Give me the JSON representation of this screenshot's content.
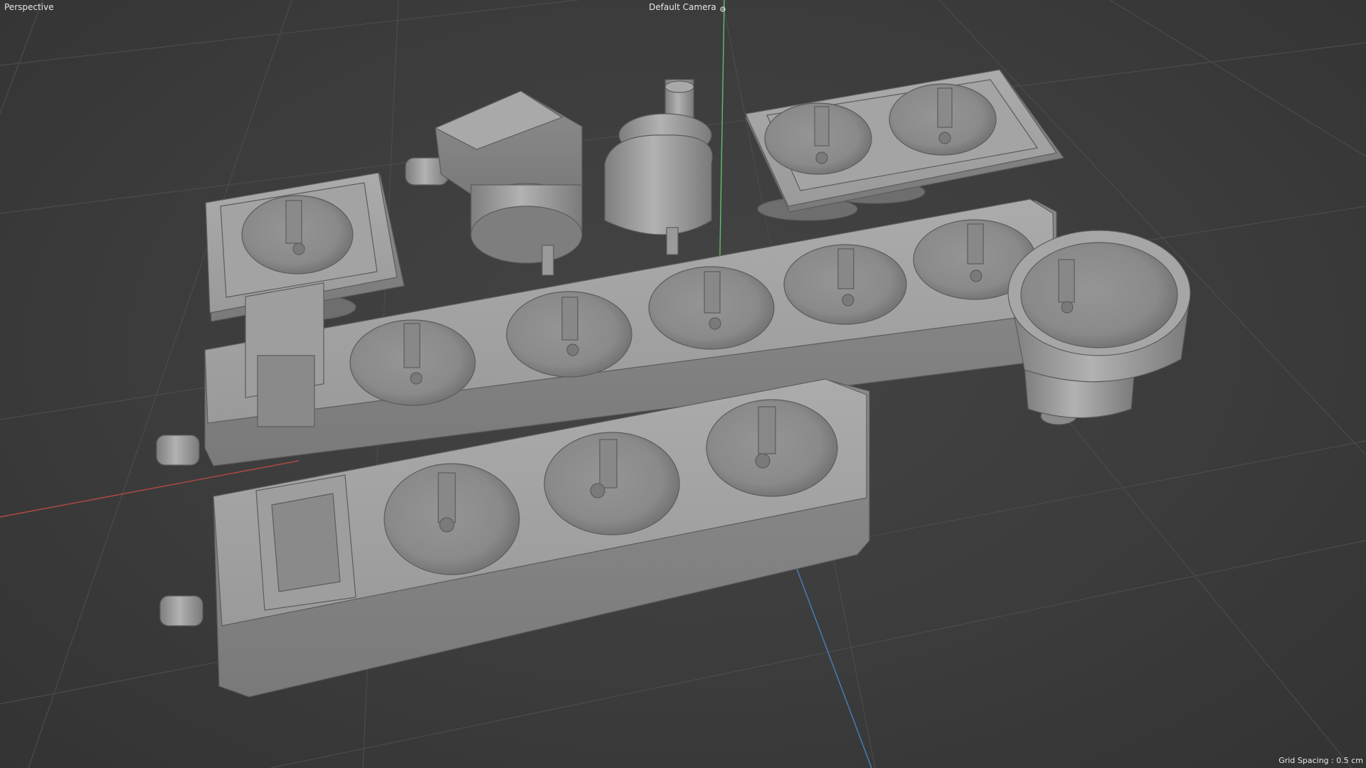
{
  "viewport": {
    "view_name": "Perspective",
    "camera_label": "Default Camera",
    "camera_icon": "camera-target-icon",
    "grid_spacing": "Grid Spacing : 0.5 cm"
  },
  "colors": {
    "background": "#3a3a3a",
    "grid_line": "#4a4a4a",
    "axis_x": "#b34a45",
    "axis_y": "#5fbf6a",
    "axis_z": "#4a7fc0",
    "model_light": "#a8a8a8",
    "model_mid": "#8f8f8f",
    "model_dark": "#6a6a6a",
    "hud_text": "#e8e8e8"
  },
  "scene": {
    "objects": [
      "power-strip-3-socket",
      "power-strip-5-socket",
      "single-wall-socket",
      "double-wall-socket",
      "angled-plug-adapter",
      "round-plug-adapter",
      "cylindrical-socket-coupler"
    ]
  }
}
